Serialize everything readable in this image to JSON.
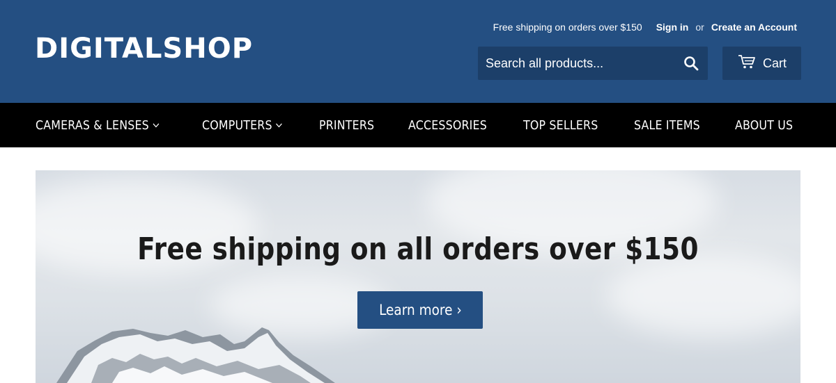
{
  "header": {
    "logo": "DIGITALSHOP",
    "promo": "Free shipping on orders over $150",
    "sign_in": "Sign in",
    "or": "or",
    "create_account": "Create an Account",
    "search_placeholder": "Search all products...",
    "cart_label": "Cart",
    "background_color": "#244f82",
    "search_icon": "search-icon",
    "cart_icon": "cart-icon"
  },
  "nav": {
    "items": [
      {
        "label": "CAMERAS & LENSES",
        "has_dropdown": true
      },
      {
        "label": "COMPUTERS",
        "has_dropdown": true
      },
      {
        "label": "PRINTERS",
        "has_dropdown": false
      },
      {
        "label": "ACCESSORIES",
        "has_dropdown": false
      },
      {
        "label": "TOP SELLERS",
        "has_dropdown": false
      },
      {
        "label": "SALE ITEMS",
        "has_dropdown": false
      },
      {
        "label": "ABOUT US",
        "has_dropdown": false
      }
    ],
    "background_color": "#000000"
  },
  "hero": {
    "title": "Free shipping on all orders over $150",
    "button_label": "Learn more ›",
    "button_color": "#244f82"
  }
}
